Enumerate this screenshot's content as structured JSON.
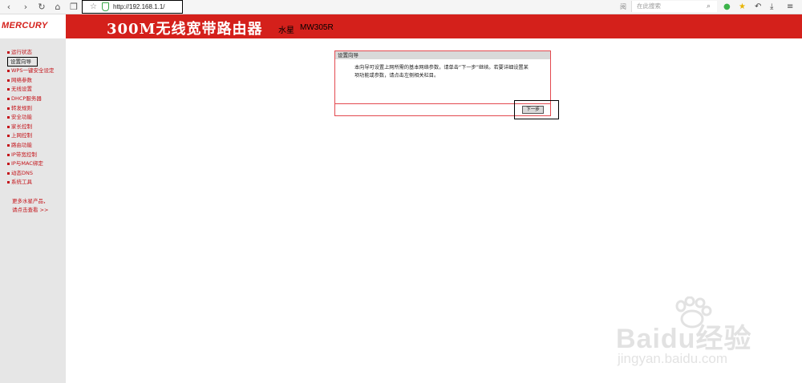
{
  "browser": {
    "nav_back": "‹",
    "nav_forward": "›",
    "reload": "↻",
    "home": "⌂",
    "reader": "❒",
    "url": "http://192.168.1.1/",
    "search_placeholder": "在此搜索",
    "reader_label": "阅"
  },
  "header": {
    "logo": "MERCURY",
    "title": "300M无线宽带路由器",
    "brand": "水星",
    "model": "MW305R",
    "bg_color": "#d4201b"
  },
  "sidebar": {
    "items": [
      {
        "label": "运行状态"
      },
      {
        "label": "设置向导"
      },
      {
        "label": "WPS一键安全设定"
      },
      {
        "label": "网络参数"
      },
      {
        "label": "无线设置"
      },
      {
        "label": "DHCP服务器"
      },
      {
        "label": "转发规则"
      },
      {
        "label": "安全功能"
      },
      {
        "label": "家长控制"
      },
      {
        "label": "上网控制"
      },
      {
        "label": "路由功能"
      },
      {
        "label": "IP带宽控制"
      },
      {
        "label": "IP与MAC绑定"
      },
      {
        "label": "动态DNS"
      },
      {
        "label": "系统工具"
      }
    ],
    "more_line1": "更多水星产品，",
    "more_line2": "请点击查看 >>"
  },
  "wizard": {
    "title": "设置向导",
    "text": "本向导可设置上网所需的基本网络参数，请单击“下一步”继续。若要详细设置某项功能或参数，请点击左侧相关栏目。",
    "next_button": "下一步"
  },
  "watermark": {
    "text": "Baidu经验",
    "sub": "jingyan.baidu.com"
  }
}
